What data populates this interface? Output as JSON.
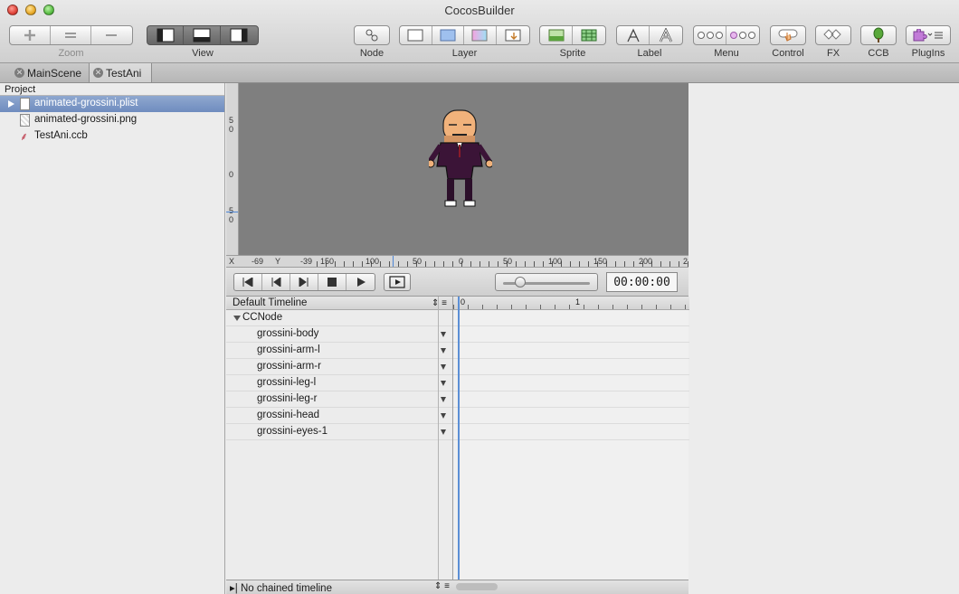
{
  "window": {
    "title": "CocosBuilder"
  },
  "toolbar": {
    "zoom_label": "Zoom",
    "view_label": "View",
    "node_label": "Node",
    "layer_label": "Layer",
    "sprite_label": "Sprite",
    "label_label": "Label",
    "menu_label": "Menu",
    "control_label": "Control",
    "fx_label": "FX",
    "ccb_label": "CCB",
    "plugins_label": "PlugIns"
  },
  "tabs": [
    {
      "label": "MainScene"
    },
    {
      "label": "TestAni"
    }
  ],
  "project": {
    "header": "Project",
    "files": [
      {
        "name": "animated-grossini.plist"
      },
      {
        "name": "animated-grossini.png"
      },
      {
        "name": "TestAni.ccb"
      }
    ]
  },
  "stage": {
    "x_label": "X",
    "x_value": "-69",
    "y_label": "Y",
    "y_value": "-39",
    "hruler_ticks": [
      "150",
      "100",
      "50",
      "0",
      "50",
      "100",
      "150",
      "200",
      "2"
    ],
    "vruler_ticks": [
      "5",
      "0",
      "0",
      "5",
      "0"
    ]
  },
  "playback": {
    "timecode": "00:00:00"
  },
  "timeline": {
    "name": "Default Timeline",
    "ruler_ticks": [
      "0",
      "1"
    ],
    "root_node": "CCNode",
    "children": [
      {
        "name": "grossini-body"
      },
      {
        "name": "grossini-arm-l"
      },
      {
        "name": "grossini-arm-r"
      },
      {
        "name": "grossini-leg-l"
      },
      {
        "name": "grossini-leg-r"
      },
      {
        "name": "grossini-head"
      },
      {
        "name": "grossini-eyes-1"
      }
    ],
    "chained": "No chained timeline"
  },
  "icons": {
    "zoom_in": "plus-icon",
    "zoom_reset": "equals-icon",
    "zoom_out": "minus-icon",
    "play": "play-icon",
    "stop": "stop-icon",
    "loop": "loop-icon"
  },
  "colors": {
    "canvas": "#7f7f7f",
    "selection": "#7a95c6",
    "playhead": "#5b8fd6"
  }
}
